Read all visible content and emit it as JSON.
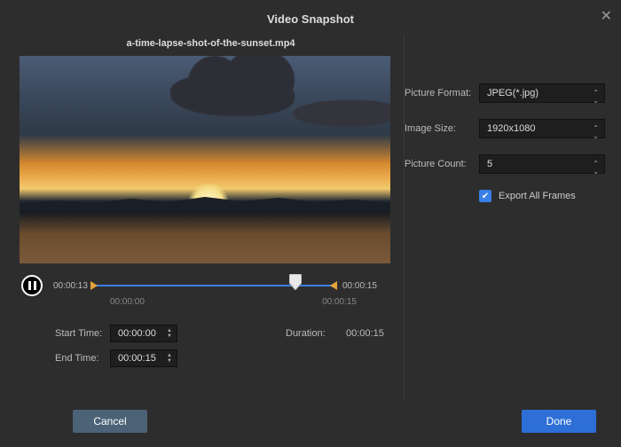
{
  "dialog": {
    "title": "Video Snapshot"
  },
  "file": {
    "name": "a-time-lapse-shot-of-the-sunset.mp4"
  },
  "playback": {
    "current_time": "00:00:13",
    "total_time": "00:00:15",
    "range_start_under": "00:00:00",
    "range_end_under": "00:00:15"
  },
  "range": {
    "start_label": "Start Time:",
    "end_label": "End Time:",
    "start_value": "00:00:00",
    "end_value": "00:00:15",
    "duration_label": "Duration:",
    "duration_value": "00:00:15"
  },
  "settings": {
    "format_label": "Picture Format:",
    "format_value": "JPEG(*.jpg)",
    "size_label": "Image Size:",
    "size_value": "1920x1080",
    "count_label": "Picture Count:",
    "count_value": "5",
    "export_all_label": "Export All Frames",
    "export_all_checked": true
  },
  "buttons": {
    "cancel": "Cancel",
    "done": "Done"
  }
}
